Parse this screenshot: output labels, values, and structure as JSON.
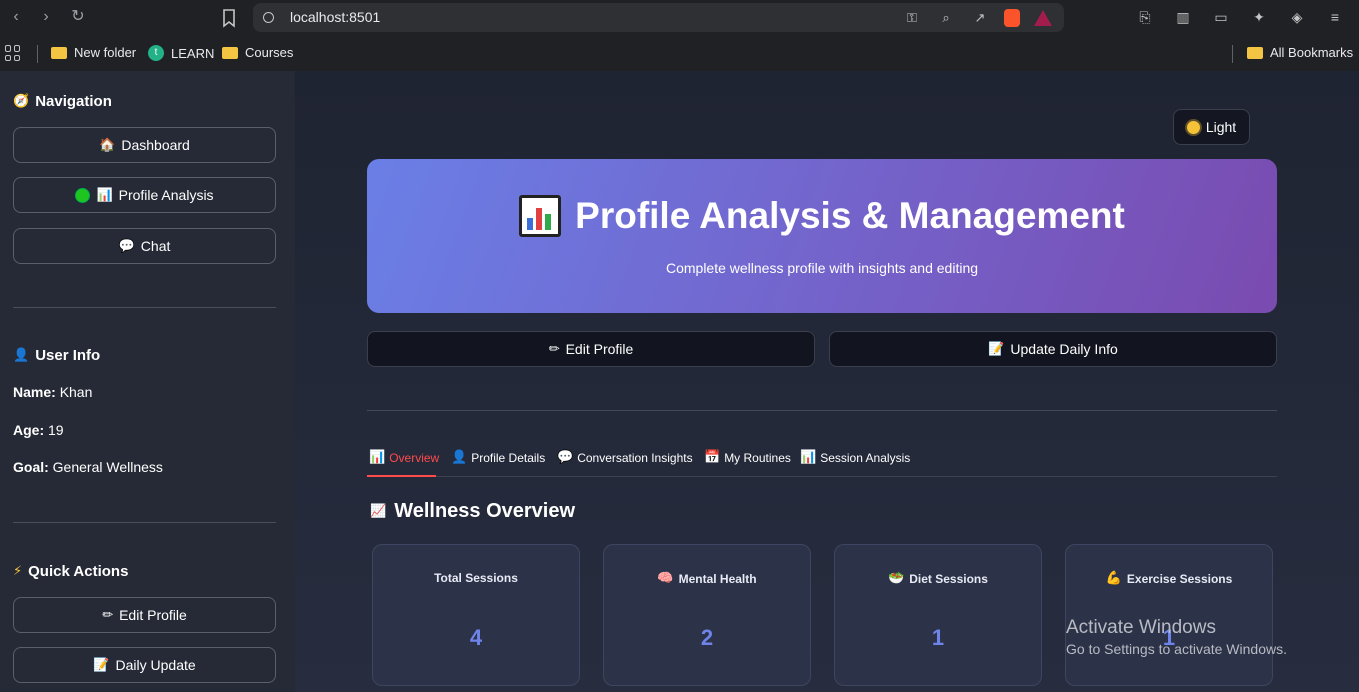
{
  "browser": {
    "url": "localhost:8501",
    "bookmarks": [
      {
        "label": "New folder",
        "icon": "folder-icon"
      },
      {
        "label": "LEARN",
        "icon": "learn-icon"
      },
      {
        "label": "Courses",
        "icon": "folder-icon"
      }
    ],
    "all_bookmarks": "All Bookmarks"
  },
  "sidebar": {
    "navigation_heading": "Navigation",
    "nav_items": [
      "Dashboard",
      "Profile Analysis",
      "Chat"
    ],
    "user_info_heading": "User Info",
    "user": {
      "name_label": "Name:",
      "name": "Khan",
      "age_label": "Age:",
      "age": "19",
      "goal_label": "Goal:",
      "goal": "General Wellness"
    },
    "quick_actions_heading": "Quick Actions",
    "quick_actions": [
      "Edit Profile",
      "Daily Update"
    ]
  },
  "main": {
    "theme_toggle": "Light",
    "hero": {
      "title": "Profile Analysis & Management",
      "subtitle": "Complete wellness profile with insights and editing"
    },
    "actions": {
      "edit_profile": "Edit Profile",
      "update_daily": "Update Daily Info"
    },
    "tabs": [
      "Overview",
      "Profile Details",
      "Conversation Insights",
      "My Routines",
      "Session Analysis"
    ],
    "active_tab": "Overview",
    "section_title": "Wellness Overview",
    "cards": [
      {
        "label": "Total Sessions",
        "value": "4",
        "icon": ""
      },
      {
        "label": "Mental Health",
        "value": "2",
        "icon": "brain-icon"
      },
      {
        "label": "Diet Sessions",
        "value": "1",
        "icon": "salad-icon"
      },
      {
        "label": "Exercise Sessions",
        "value": "1",
        "icon": "flexed-arm-icon"
      }
    ]
  },
  "watermark": {
    "title": "Activate Windows",
    "subtitle": "Go to Settings to activate Windows."
  },
  "colors": {
    "accent": "#ff4b4b",
    "metric_value": "#6f84ea",
    "hero_gradient_start": "#6a7fe6",
    "hero_gradient_end": "#7a4bb0",
    "status_online": "#1ec51e"
  }
}
